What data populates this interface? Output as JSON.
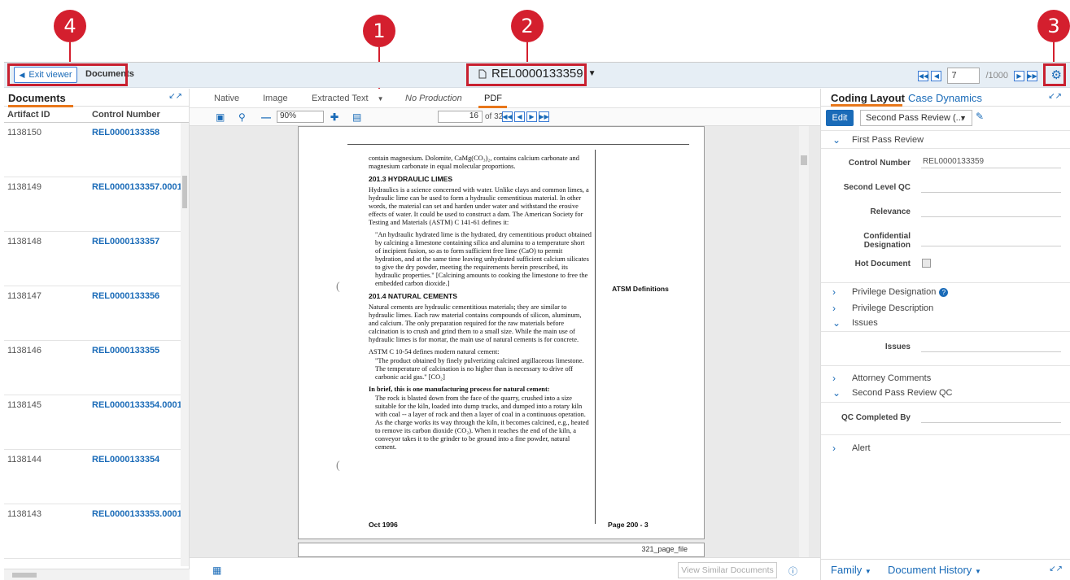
{
  "callouts": [
    "1",
    "2",
    "3",
    "4"
  ],
  "topbar": {
    "exit_label": "Exit viewer",
    "breadcrumb": "Documents",
    "doc_title": "REL0000133359",
    "page_value": "7",
    "page_total": "/1000"
  },
  "documents_panel": {
    "title": "Documents",
    "columns": [
      "Artifact ID",
      "Control Number"
    ],
    "rows": [
      {
        "id": "1138150",
        "cn": "REL0000133358"
      },
      {
        "id": "1138149",
        "cn": "REL0000133357.0001"
      },
      {
        "id": "1138148",
        "cn": "REL0000133357"
      },
      {
        "id": "1138147",
        "cn": "REL0000133356"
      },
      {
        "id": "1138146",
        "cn": "REL0000133355"
      },
      {
        "id": "1138145",
        "cn": "REL0000133354.0001"
      },
      {
        "id": "1138144",
        "cn": "REL0000133354"
      },
      {
        "id": "1138143",
        "cn": "REL0000133353.0001"
      }
    ]
  },
  "viewer": {
    "tabs": [
      "Native",
      "Image",
      "Extracted Text",
      "No Production",
      "PDF"
    ],
    "zoom": "90%",
    "page": "16",
    "page_of": "of 321",
    "page_file_label": "321_page_file",
    "view_similar": "View Similar Documents"
  },
  "document_page": {
    "para1": "contain magnesium. Dolomite, CaMg(CO₃)₂, contains calcium carbonate and magnesium carbonate in equal molecular proportions.",
    "h1": "201.3 HYDRAULIC LIMES",
    "para2": "Hydraulics is a science concerned with water. Unlike clays and common limes, a hydraulic lime can be used to form a hydraulic cementitious material. In other words, the material can set and harden under water and withstand the erosive effects of water. It could be used to construct a dam. The American Society for Testing and Materials (ASTM) C 141-61 defines it:",
    "quote1": "\"An hydraulic hydrated lime is the hydrated, dry cementitious product obtained by calcining a limestone containing silica and alumina to a temperature short of incipient fusion, so as to form sufficient free lime (CaO) to permit hydration, and at the same time leaving unhydrated sufficient calcium silicates to give the dry powder, meeting the requirements herein prescribed, its hydraulic properties.\" [Calcining amounts to cooking the limestone to free the embedded carbon dioxide.]",
    "side_note": "ATSM Definitions",
    "h2": "201.4 NATURAL CEMENTS",
    "para3": "Natural cements are hydraulic cementitious materials; they are similar to hydraulic limes. Each raw material contains compounds of silicon, aluminum, and calcium. The only preparation required for the raw materials before calcination is to crush and grind them to a small size. While the main use of hydraulic limes is for mortar, the main use of natural cements is for concrete.",
    "para4": "ASTM C 10-54 defines modern natural cement:",
    "quote2": "\"The product obtained by finely pulverizing calcined argillaceous limestone. The temperature of calcination is no higher than is necessary to drive off carbonic acid gas.\" [CO₂]",
    "para5_head": "In brief, this is one manufacturing process for natural cement:",
    "para5": "The rock is blasted down from the face of the quarry, crushed into a size suitable for the kiln, loaded into dump trucks, and dumped into a rotary kiln with coal -- a layer of rock and then a layer of coal in a continuous operation. As the charge works its way through the kiln, it becomes calcined, e.g., heated to remove its carbon dioxide (CO₂). When it reaches the end of the kiln, a conveyor takes it to the grinder to be ground into a fine powder, natural cement.",
    "footer_left": "Oct 1996",
    "footer_right": "Page 200 - 3"
  },
  "coding_panel": {
    "tab1": "Coding Layout",
    "tab2": "Case Dynamics",
    "edit": "Edit",
    "layout_select": "Second Pass Review (...",
    "sections": {
      "first_pass": "First Pass Review",
      "privilege_designation": "Privilege Designation",
      "privilege_description": "Privilege Description",
      "issues": "Issues",
      "attorney_comments": "Attorney Comments",
      "second_pass": "Second Pass Review QC",
      "alert": "Alert"
    },
    "fields": {
      "control_number_label": "Control Number",
      "control_number_value": "REL0000133359",
      "second_level_qc": "Second Level QC",
      "relevance": "Relevance",
      "confidential_designation": "Confidential Designation",
      "hot_document": "Hot Document",
      "issues_label": "Issues",
      "qc_completed_by": "QC Completed By"
    },
    "bottom_family": "Family",
    "bottom_history": "Document History"
  }
}
